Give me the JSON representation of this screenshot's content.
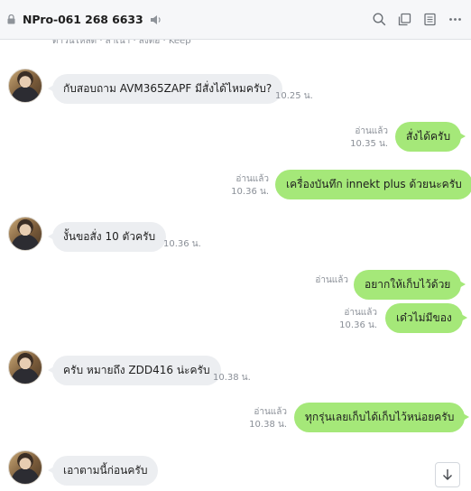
{
  "header": {
    "title": "NPro-061 268 6633",
    "icons": [
      "lock-icon",
      "speaker-icon",
      "search-icon",
      "copy-icon",
      "notes-icon",
      "more-icon"
    ]
  },
  "chat": {
    "previous_bar_text": "ดาวน์โหลด · สำเนา · ส่งต่อ · Keep",
    "messages": [
      {
        "direction": "in",
        "text": "กับสอบถาม AVM365ZAPF มีสั่งได้ไหมครับ?",
        "time": "10.25 น."
      },
      {
        "direction": "out",
        "text": "สั่งได้ครับ",
        "read": "อ่านแล้ว",
        "time": "10.35 น."
      },
      {
        "direction": "out",
        "text": "เครื่องบันทึก innekt plus ด้วยนะครับ",
        "read": "อ่านแล้ว",
        "time": "10.36 น."
      },
      {
        "direction": "in",
        "text": "งั้นขอสั่ง 10 ตัวครับ",
        "time": "10.36 น."
      },
      {
        "direction": "out",
        "text": "อยากให้เก็บไว้ด้วย",
        "read": "อ่านแล้ว",
        "time": ""
      },
      {
        "direction": "out",
        "text": "เด๋วไม่มีของ",
        "read": "อ่านแล้ว",
        "time": "10.36 น."
      },
      {
        "direction": "in",
        "text": "ครับ หมายถึง ZDD416 น่ะครับ",
        "time": "10.38 น."
      },
      {
        "direction": "out",
        "text": "ทุกรุ่นเลยเก็บได้เก็บไว้หน่อยครับ",
        "read": "อ่านแล้ว",
        "time": "10.38 น."
      },
      {
        "direction": "in",
        "text": "เอาตามนี้ก่อนครับ",
        "time": ""
      }
    ]
  },
  "colors": {
    "header_bg": "#f6f7f9",
    "incoming_bubble": "#eceef1",
    "outgoing_bubble": "#a5e879",
    "meta_text": "#8a8f97"
  }
}
